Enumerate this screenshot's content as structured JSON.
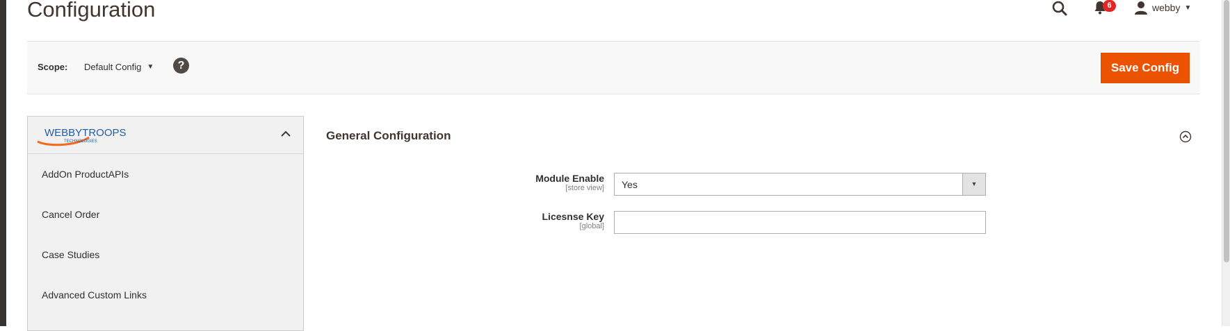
{
  "page": {
    "title": "Configuration"
  },
  "header": {
    "notifications_count": "6",
    "user_name": "webby",
    "icons": {
      "search": "search-icon",
      "notifications": "bell-icon",
      "user": "user-icon"
    }
  },
  "scope": {
    "label": "Scope:",
    "value": "Default Config",
    "help": "?"
  },
  "toolbar": {
    "save_label": "Save Config"
  },
  "sidebar": {
    "brand_top": "WEBBYTROOPS",
    "brand_bottom": "TECHNOLOGIES",
    "items": [
      {
        "label": "AddOn ProductAPIs"
      },
      {
        "label": "Cancel Order"
      },
      {
        "label": "Case Studies"
      },
      {
        "label": "Advanced Custom Links"
      }
    ]
  },
  "section": {
    "title": "General Configuration",
    "fields": [
      {
        "label": "Module Enable",
        "scope": "[store view]",
        "value": "Yes",
        "type": "select"
      },
      {
        "label": "Licesnse Key",
        "scope": "[global]",
        "value": "",
        "type": "text"
      }
    ]
  },
  "colors": {
    "accent": "#eb5202",
    "badge": "#e22626",
    "title": "#41362f"
  }
}
